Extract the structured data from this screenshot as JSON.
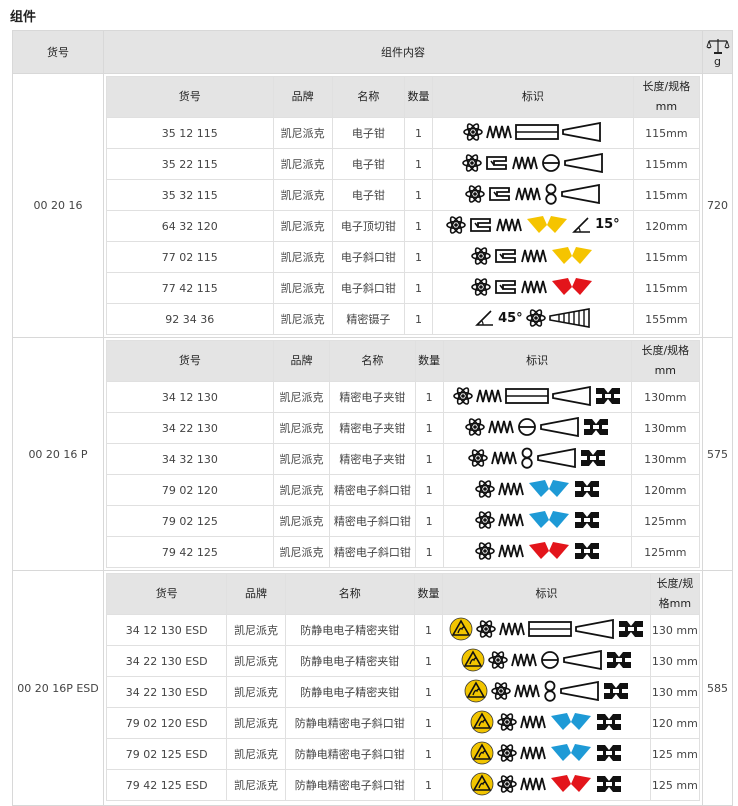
{
  "title": "组件",
  "header": {
    "sku": "货号",
    "contents": "组件内容",
    "weight_unit": "g"
  },
  "colors": {
    "header_bg": "#e4e4e4",
    "border": "#d8d8d8",
    "yellow": "#f5c400",
    "blue": "#1e9ad6",
    "red": "#e3151b",
    "esd_yellow": "#f2c500"
  },
  "cols": {
    "sku": "货号",
    "brand": "品牌",
    "name": "名称",
    "qty": "数量",
    "marks": "标识",
    "length": "长度/规格mm"
  },
  "sets": [
    {
      "sku": "00 20 16",
      "weight": "720",
      "rows": [
        {
          "sku": "35 12 115",
          "brand": "凯尼派克",
          "name": "电子钳",
          "qty": "1",
          "marks": [
            "atom-icon",
            "spring-icon",
            "flat-tip-icon",
            "taper-icon"
          ],
          "length": "115mm"
        },
        {
          "sku": "35 22 115",
          "brand": "凯尼派克",
          "name": "电子钳",
          "qty": "1",
          "marks": [
            "atom-icon",
            "box-joint-icon",
            "spring-icon",
            "round-tip-icon",
            "taper-icon"
          ],
          "length": "115mm"
        },
        {
          "sku": "35 32 115",
          "brand": "凯尼派克",
          "name": "电子钳",
          "qty": "1",
          "marks": [
            "atom-icon",
            "box-joint-icon",
            "spring-icon",
            "figure8-icon",
            "taper-icon"
          ],
          "length": "115mm"
        },
        {
          "sku": "64 32 120",
          "brand": "凯尼派克",
          "name": "电子顶切钳",
          "qty": "1",
          "marks": [
            "atom-icon",
            "box-joint-icon",
            "spring-icon",
            "yellow-cutter-icon",
            "angle-icon"
          ],
          "angle": "15°",
          "length": "120mm"
        },
        {
          "sku": "77 02 115",
          "brand": "凯尼派克",
          "name": "电子斜口钳",
          "qty": "1",
          "marks": [
            "atom-icon",
            "box-joint-icon",
            "spring-icon",
            "yellow-cutter-icon"
          ],
          "length": "115mm"
        },
        {
          "sku": "77 42 115",
          "brand": "凯尼派克",
          "name": "电子斜口钳",
          "qty": "1",
          "marks": [
            "atom-icon",
            "box-joint-icon",
            "spring-icon",
            "red-cutter-icon"
          ],
          "length": "115mm"
        },
        {
          "sku": "92 34 36",
          "brand": "凯尼派克",
          "name": "精密镊子",
          "qty": "1",
          "marks": [
            "angle-icon",
            "atom-icon",
            "tweezer-tip-icon"
          ],
          "angle": "45°",
          "length": "155mm"
        }
      ]
    },
    {
      "sku": "00 20 16 P",
      "weight": "575",
      "rows": [
        {
          "sku": "34 12 130",
          "brand": "凯尼派克",
          "name": "精密电子夹钳",
          "qty": "1",
          "marks": [
            "atom-icon",
            "spring-icon",
            "flat-tip-icon",
            "taper-icon",
            "grip-icon"
          ],
          "length": "130mm"
        },
        {
          "sku": "34 22 130",
          "brand": "凯尼派克",
          "name": "精密电子夹钳",
          "qty": "1",
          "marks": [
            "atom-icon",
            "spring-icon",
            "round-tip-icon",
            "taper-icon",
            "grip-icon"
          ],
          "length": "130mm"
        },
        {
          "sku": "34 32 130",
          "brand": "凯尼派克",
          "name": "精密电子夹钳",
          "qty": "1",
          "marks": [
            "atom-icon",
            "spring-icon",
            "figure8-icon",
            "taper-icon",
            "grip-icon"
          ],
          "length": "130mm"
        },
        {
          "sku": "79 02 120",
          "brand": "凯尼派克",
          "name": "精密电子斜口钳",
          "qty": "1",
          "marks": [
            "atom-icon",
            "spring-icon",
            "blue-cutter-icon",
            "grip-icon"
          ],
          "length": "120mm"
        },
        {
          "sku": "79 02 125",
          "brand": "凯尼派克",
          "name": "精密电子斜口钳",
          "qty": "1",
          "marks": [
            "atom-icon",
            "spring-icon",
            "blue-cutter-icon",
            "grip-icon"
          ],
          "length": "125mm"
        },
        {
          "sku": "79 42 125",
          "brand": "凯尼派克",
          "name": "精密电子斜口钳",
          "qty": "1",
          "marks": [
            "atom-icon",
            "spring-icon",
            "red-cutter-icon",
            "grip-icon"
          ],
          "length": "125mm"
        }
      ]
    },
    {
      "sku": "00 20 16P ESD",
      "weight": "585",
      "rows": [
        {
          "sku": "34 12 130 ESD",
          "brand": "凯尼派克",
          "name": "防静电电子精密夹钳",
          "qty": "1",
          "marks": [
            "esd-icon",
            "atom-icon",
            "spring-icon",
            "flat-tip-icon",
            "taper-icon",
            "grip-icon"
          ],
          "length": "130 mm"
        },
        {
          "sku": "34 22 130 ESD",
          "brand": "凯尼派克",
          "name": "防静电电子精密夹钳",
          "qty": "1",
          "marks": [
            "esd-icon",
            "atom-icon",
            "spring-icon",
            "round-tip-icon",
            "taper-icon",
            "grip-icon"
          ],
          "length": "130 mm"
        },
        {
          "sku": "34 22 130 ESD",
          "brand": "凯尼派克",
          "name": "防静电电子精密夹钳",
          "qty": "1",
          "marks": [
            "esd-icon",
            "atom-icon",
            "spring-icon",
            "figure8-icon",
            "taper-icon",
            "grip-icon"
          ],
          "length": "130 mm"
        },
        {
          "sku": "79 02 120 ESD",
          "brand": "凯尼派克",
          "name": "防静电精密电子斜口钳",
          "qty": "1",
          "marks": [
            "esd-icon",
            "atom-icon",
            "spring-icon",
            "blue-cutter-icon",
            "grip-icon"
          ],
          "length": "120 mm"
        },
        {
          "sku": "79 02 125 ESD",
          "brand": "凯尼派克",
          "name": "防静电精密电子斜口钳",
          "qty": "1",
          "marks": [
            "esd-icon",
            "atom-icon",
            "spring-icon",
            "blue-cutter-icon",
            "grip-icon"
          ],
          "length": "125 mm"
        },
        {
          "sku": "79 42 125 ESD",
          "brand": "凯尼派克",
          "name": "防静电精密电子斜口钳",
          "qty": "1",
          "marks": [
            "esd-icon",
            "atom-icon",
            "spring-icon",
            "red-cutter-icon",
            "grip-icon"
          ],
          "length": "125 mm"
        }
      ]
    }
  ]
}
